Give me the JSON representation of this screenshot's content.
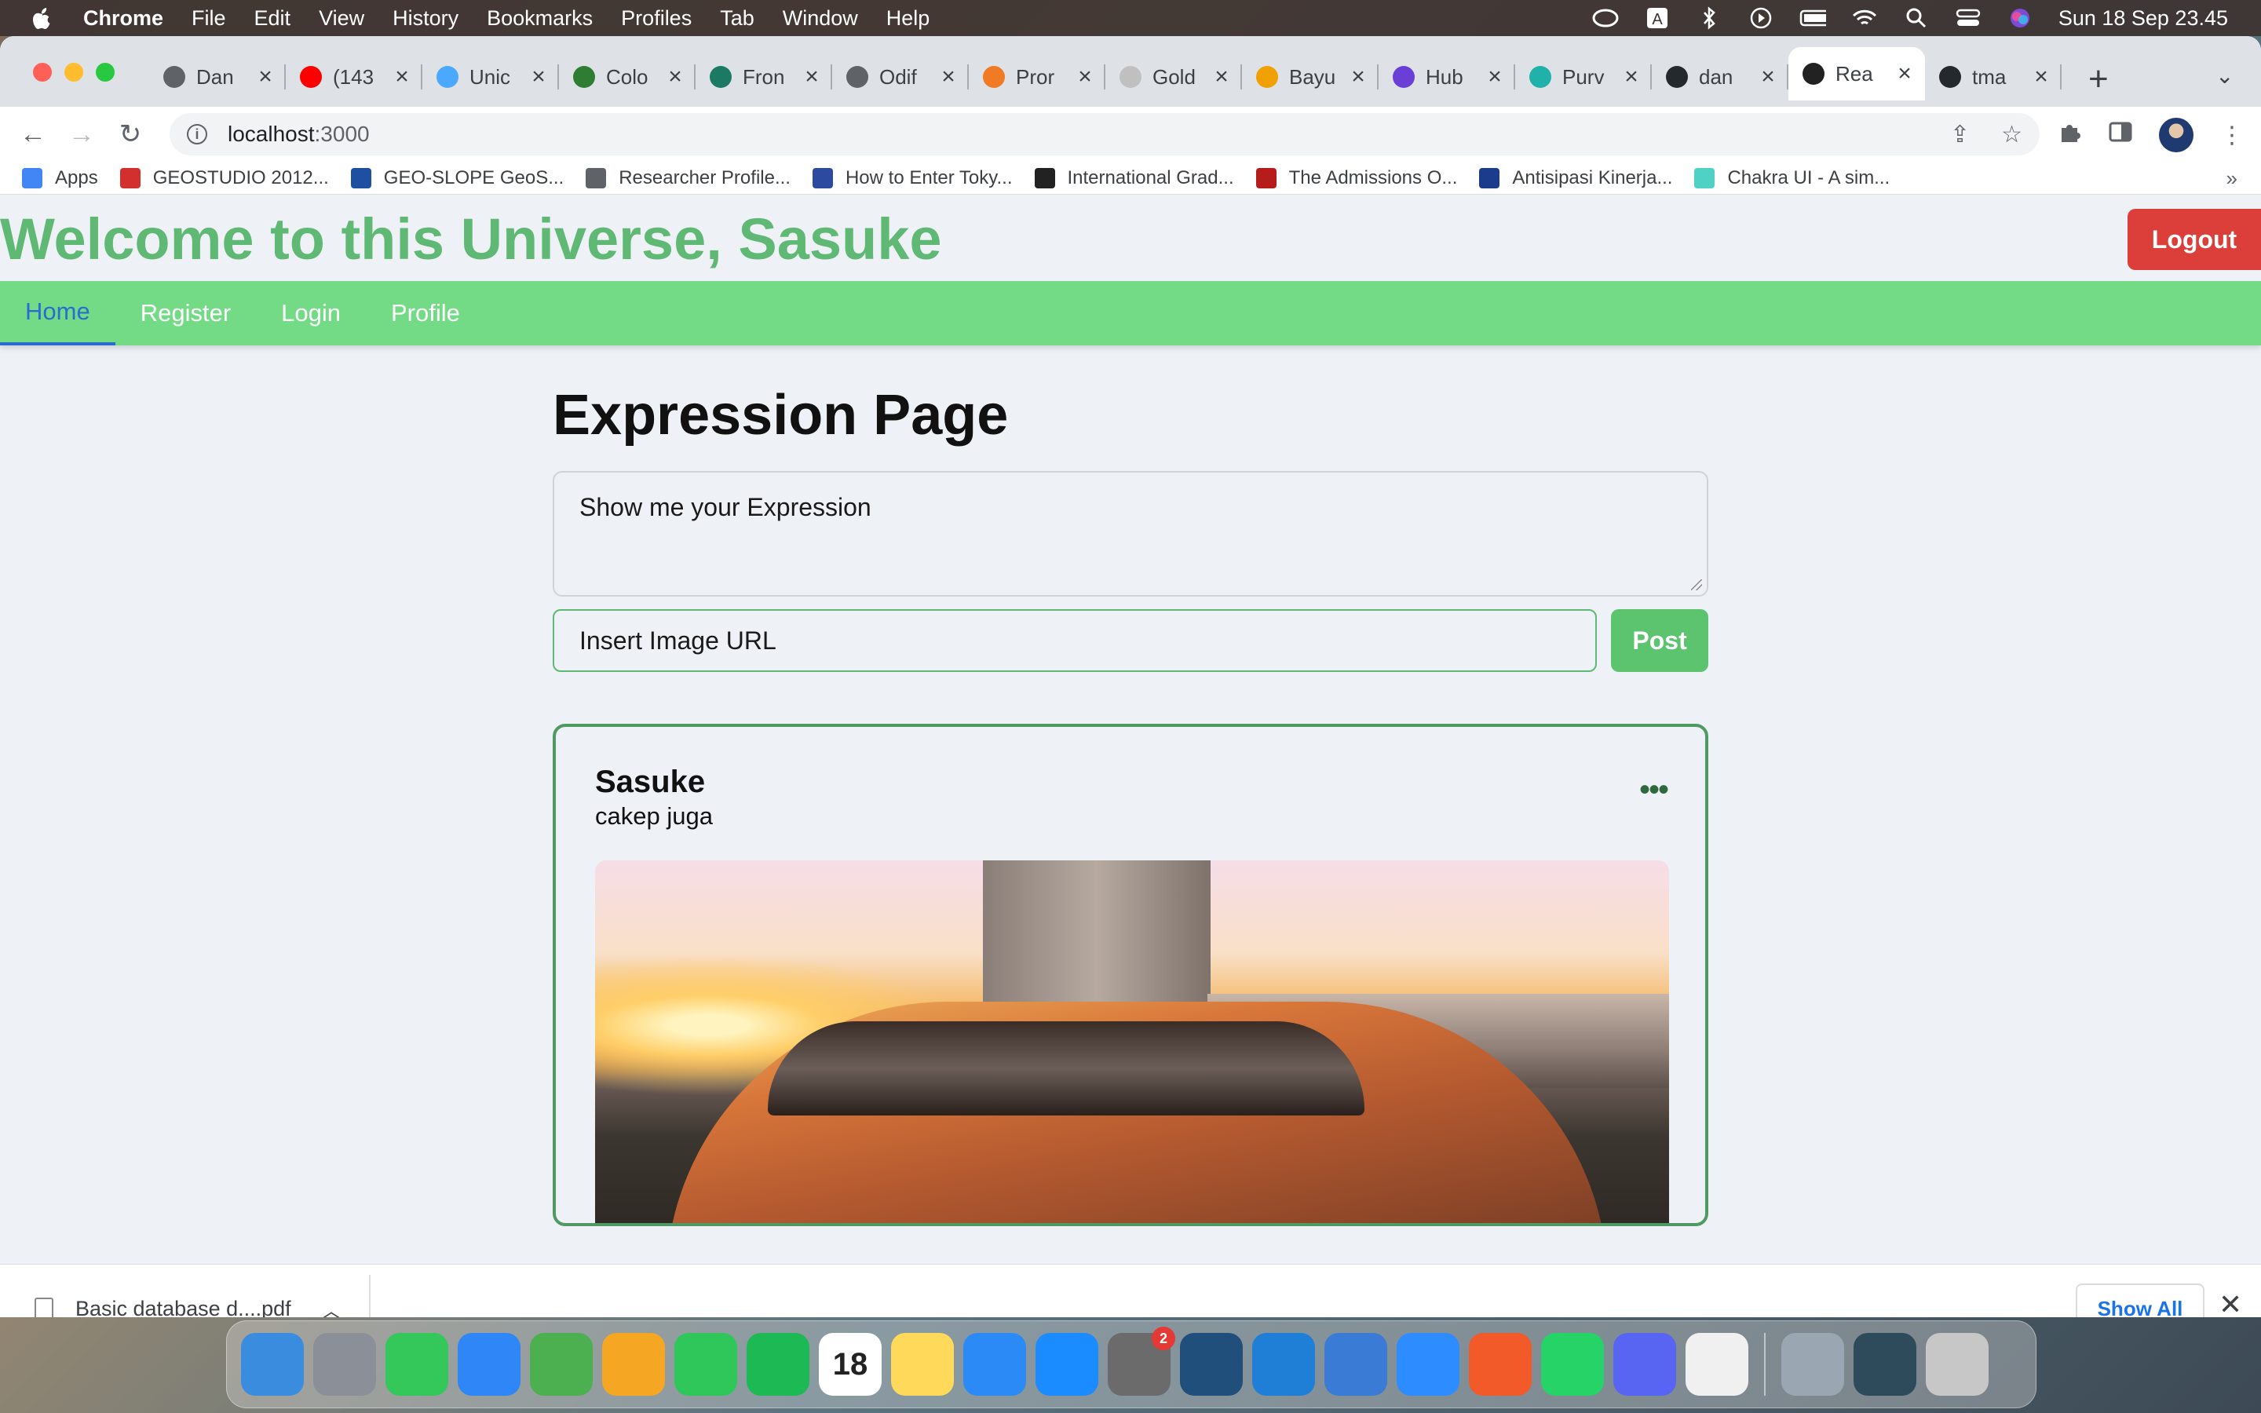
{
  "menubar": {
    "app_name": "Chrome",
    "menus": [
      "File",
      "Edit",
      "View",
      "History",
      "Bookmarks",
      "Profiles",
      "Tab",
      "Window",
      "Help"
    ],
    "clock": "Sun 18 Sep  23.45",
    "status_icons": [
      "creative-cloud-icon",
      "input-source-icon",
      "bluetooth-icon",
      "play-icon",
      "battery-icon",
      "wifi-icon",
      "spotlight-search-icon",
      "control-center-icon",
      "siri-icon"
    ]
  },
  "tabs": [
    {
      "title": "Dan",
      "color": "#5f6368"
    },
    {
      "title": "(143",
      "color": "#ff0000"
    },
    {
      "title": "Unic",
      "color": "#4aa8ff"
    },
    {
      "title": "Colo",
      "color": "#2e7d32"
    },
    {
      "title": "Fron",
      "color": "#1b7a64"
    },
    {
      "title": "Odif",
      "color": "#5f6368"
    },
    {
      "title": "Pror",
      "color": "#f07b24"
    },
    {
      "title": "Gold",
      "color": "#c0c0c0"
    },
    {
      "title": "Bayu",
      "color": "#f0a000"
    },
    {
      "title": "Hub",
      "color": "#6a3fd8"
    },
    {
      "title": "Purv",
      "color": "#20b2aa"
    },
    {
      "title": "dan",
      "color": "#24292e"
    },
    {
      "title": "Rea",
      "color": "#222"
    },
    {
      "title": "tma",
      "color": "#24292e"
    }
  ],
  "active_tab_index": 12,
  "address_bar": {
    "host": "localhost",
    "port": ":3000"
  },
  "bookmarks": [
    {
      "label": "Apps",
      "color": "#4285f4"
    },
    {
      "label": "GEOSTUDIO 2012...",
      "color": "#d32f2f"
    },
    {
      "label": "GEO-SLOPE GeoS...",
      "color": "#1e4fa0"
    },
    {
      "label": "Researcher Profile...",
      "color": "#5f6368"
    },
    {
      "label": "How to Enter Toky...",
      "color": "#2b4aa0"
    },
    {
      "label": "International Grad...",
      "color": "#222"
    },
    {
      "label": "The Admissions O...",
      "color": "#b71c1c"
    },
    {
      "label": "Antisipasi Kinerja...",
      "color": "#1a3c8a"
    },
    {
      "label": "Chakra UI - A sim...",
      "color": "#4fd1c5"
    }
  ],
  "header": {
    "welcome": "Welcome to this Universe, Sasuke",
    "logout_label": "Logout"
  },
  "nav": [
    {
      "label": "Home",
      "active": true
    },
    {
      "label": "Register",
      "active": false
    },
    {
      "label": "Login",
      "active": false
    },
    {
      "label": "Profile",
      "active": false
    }
  ],
  "main": {
    "title": "Expression Page",
    "expression_placeholder": "Show me your Expression",
    "image_url_placeholder": "Insert Image URL",
    "post_label": "Post"
  },
  "post": {
    "author": "Sasuke",
    "text": "cakep juga",
    "menu_icon": "more-horizontal-icon"
  },
  "downloads": {
    "file_name": "Basic database d....pdf",
    "show_all_label": "Show All"
  },
  "dock": [
    {
      "name": "finder",
      "color": "#3a8dde"
    },
    {
      "name": "launchpad",
      "color": "#8a8f98"
    },
    {
      "name": "messages",
      "color": "#34c759"
    },
    {
      "name": "mail",
      "color": "#2f86f6"
    },
    {
      "name": "maps",
      "color": "#4caf50"
    },
    {
      "name": "photos",
      "color": "#f5a623"
    },
    {
      "name": "facetime",
      "color": "#30c75a"
    },
    {
      "name": "spotify",
      "color": "#1db954"
    },
    {
      "name": "calendar",
      "color": "#ffffff",
      "text": "18"
    },
    {
      "name": "notes",
      "color": "#ffd95a"
    },
    {
      "name": "keynote",
      "color": "#2b8af6"
    },
    {
      "name": "app-store",
      "color": "#1a8cff"
    },
    {
      "name": "system-preferences",
      "color": "#6b6b6b",
      "badge": "2"
    },
    {
      "name": "mysql-workbench",
      "color": "#1f4f7a"
    },
    {
      "name": "vscode",
      "color": "#1f7ed6"
    },
    {
      "name": "xcode",
      "color": "#3a7bd5"
    },
    {
      "name": "zoom",
      "color": "#2d8cff"
    },
    {
      "name": "sketch-pen",
      "color": "#f25a2a"
    },
    {
      "name": "whatsapp",
      "color": "#25d366"
    },
    {
      "name": "discord",
      "color": "#5865f2"
    },
    {
      "name": "chrome",
      "color": "#f0f0f0"
    },
    {
      "name": "preview",
      "color": "#9aa7b3"
    },
    {
      "name": "screenshot",
      "color": "#2e4b5c"
    },
    {
      "name": "trash",
      "color": "#c7c7c7"
    }
  ]
}
